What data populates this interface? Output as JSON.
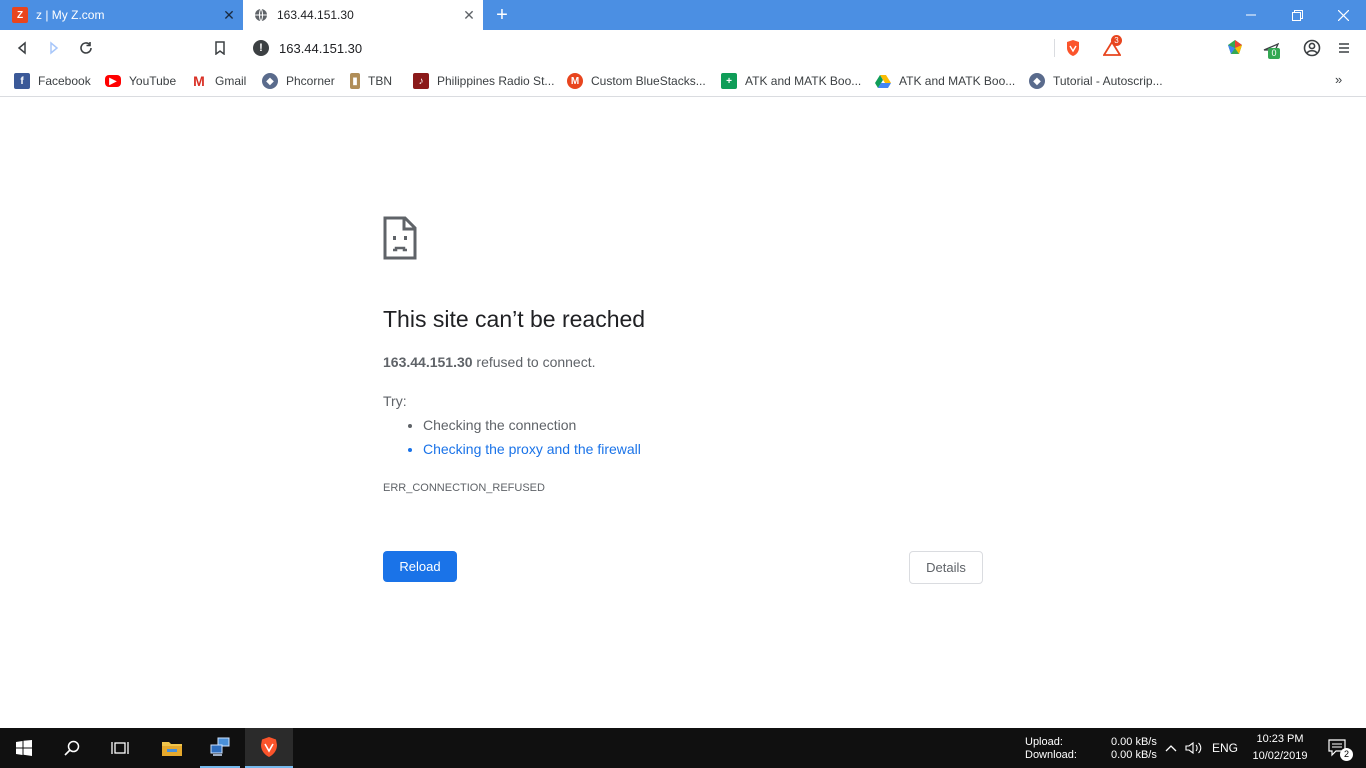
{
  "tabs": [
    {
      "title": "z | My Z.com",
      "active": false,
      "icon": "z-com-icon"
    },
    {
      "title": "163.44.151.30",
      "active": true,
      "icon": "globe-icon"
    }
  ],
  "toolbar": {
    "url": "163.44.151.30",
    "brave_rewards_count": "3",
    "extension_badge": "0"
  },
  "bookmarks": [
    {
      "label": "Facebook",
      "icon": "facebook-icon",
      "color": "#3b5998"
    },
    {
      "label": "YouTube",
      "icon": "youtube-icon",
      "color": "#ff0000"
    },
    {
      "label": "Gmail",
      "icon": "gmail-icon",
      "color": "#d93025"
    },
    {
      "label": "Phcorner",
      "icon": "phcorner-icon",
      "color": "#5a6b8c"
    },
    {
      "label": "TBN",
      "icon": "tbn-icon",
      "color": "#b08d57"
    },
    {
      "label": "Philippines Radio St...",
      "icon": "radio-icon",
      "color": "#8b1a1a"
    },
    {
      "label": "Custom BlueStacks...",
      "icon": "bluestacks-icon",
      "color": "#e8451e"
    },
    {
      "label": "ATK and MATK Boo...",
      "icon": "sheets-icon",
      "color": "#0f9d58"
    },
    {
      "label": "ATK and MATK Boo...",
      "icon": "drive-icon",
      "color": "#fbbc04"
    },
    {
      "label": "Tutorial - Autoscrip...",
      "icon": "phcorner-icon",
      "color": "#5a6b8c"
    }
  ],
  "error": {
    "title": "This site can’t be reached",
    "host": "163.44.151.30",
    "desc_suffix": " refused to connect.",
    "try_label": "Try:",
    "suggestions": [
      {
        "text": "Checking the connection",
        "link": false
      },
      {
        "text": "Checking the proxy and the firewall",
        "link": true
      }
    ],
    "code": "ERR_CONNECTION_REFUSED",
    "reload_label": "Reload",
    "details_label": "Details"
  },
  "taskbar": {
    "upload_label": "Upload:",
    "download_label": "Download:",
    "upload_value": "0.00 kB/s",
    "download_value": "0.00 kB/s",
    "language": "ENG",
    "time": "10:23 PM",
    "date": "10/02/2019",
    "notification_count": "2"
  },
  "colors": {
    "tabstrip": "#4b8fe3",
    "accent": "#1a73e8",
    "taskbar": "#101010"
  }
}
